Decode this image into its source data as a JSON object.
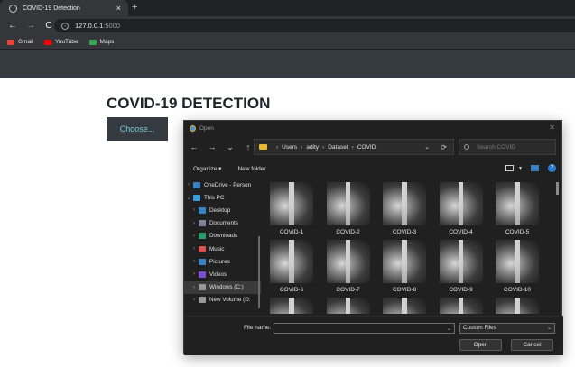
{
  "browser": {
    "tab_title": "COVID-19 Detection",
    "tab_close": "×",
    "new_tab": "+",
    "url_host": "127.0.0.1",
    "url_port": ":5000",
    "bookmarks": [
      {
        "label": "Gmail",
        "icon": "gmail-icon",
        "color": "#ea4335"
      },
      {
        "label": "YouTube",
        "icon": "youtube-icon",
        "color": "#ff0000"
      },
      {
        "label": "Maps",
        "icon": "maps-icon",
        "color": "#34a853"
      }
    ]
  },
  "page": {
    "title": "COVID-19 DETECTION",
    "choose_label": "Choose..."
  },
  "dialog": {
    "title": "Open",
    "breadcrumb": [
      "Users",
      "adity",
      "Dataset",
      "COVID"
    ],
    "search_placeholder": "Search COVID",
    "organize_label": "Organize ▾",
    "new_folder_label": "New folder",
    "nav_items": [
      {
        "label": "OneDrive - Person",
        "icon": "onedrive-icon",
        "color": "#3b82c4",
        "chev": "›"
      },
      {
        "label": "This PC",
        "icon": "pc-icon",
        "color": "#3b9cd9",
        "chev": "⌄"
      },
      {
        "label": "Desktop",
        "icon": "desktop-icon",
        "color": "#3b82c4",
        "chev": "›"
      },
      {
        "label": "Documents",
        "icon": "documents-icon",
        "color": "#7a8a9a",
        "chev": "›"
      },
      {
        "label": "Downloads",
        "icon": "downloads-icon",
        "color": "#2e9d6b",
        "chev": "›"
      },
      {
        "label": "Music",
        "icon": "music-icon",
        "color": "#d9534f",
        "chev": "›"
      },
      {
        "label": "Pictures",
        "icon": "pictures-icon",
        "color": "#3b82c4",
        "chev": "›"
      },
      {
        "label": "Videos",
        "icon": "videos-icon",
        "color": "#7b4fd0",
        "chev": "›"
      },
      {
        "label": "Windows (C:)",
        "icon": "drive-icon",
        "color": "#9a9a9a",
        "chev": "›"
      },
      {
        "label": "New Volume (D:",
        "icon": "drive-icon",
        "color": "#9a9a9a",
        "chev": "›"
      }
    ],
    "selected_nav_index": 8,
    "files": [
      "COVID-1",
      "COVID-2",
      "COVID-3",
      "COVID-4",
      "COVID-5",
      "COVID-6",
      "COVID-7",
      "COVID-8",
      "COVID-9",
      "COVID-10",
      "",
      "",
      "",
      "",
      ""
    ],
    "file_name_label": "File name:",
    "file_name_value": "",
    "filter_value": "Custom Files",
    "open_label": "Open",
    "cancel_label": "Cancel"
  }
}
